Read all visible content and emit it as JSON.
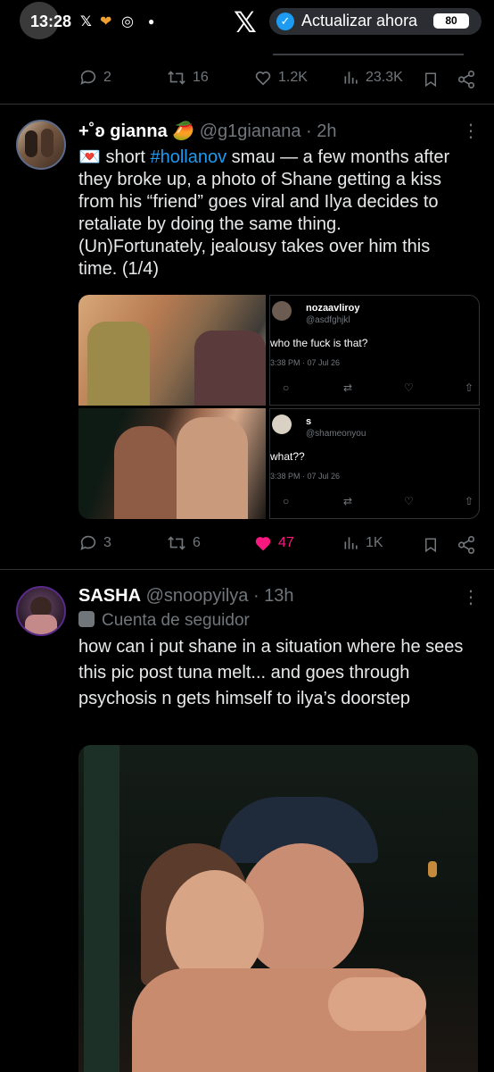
{
  "status_bar": {
    "time": "13:28",
    "app_icons": [
      "x-icon",
      "heart-icon",
      "whatsapp-icon",
      "dot-icon"
    ],
    "update_text": "Actualizar ahora",
    "battery": "80"
  },
  "tweet1": {
    "replies": "2",
    "retweets": "16",
    "likes": "1.2K",
    "views": "23.3K"
  },
  "tweet2": {
    "name": "+˚ʚ gianna 🥭",
    "handle": "@g1gianana",
    "time": "2h",
    "text_emoji": "💌",
    "text_before": " short ",
    "hashtag": "#hollanov",
    "text_after": " smau — a few months after they broke up, a photo of Shane getting a kiss from his “friend” goes viral and Ilya decides to retaliate by doing the same thing. (Un)Fortunately, jealousy takes over him this time. (1/4)",
    "embedded": [
      {
        "user": "nozaavliroy",
        "handle": "@asdfghjkl",
        "text": "who the fuck is that?",
        "timestamp": "3:38 PM · 07 Jul 26"
      },
      {
        "user": "s",
        "handle": "@shameonyou",
        "text": "what??",
        "timestamp": "3:38 PM · 07 Jul 26"
      }
    ],
    "replies": "3",
    "retweets": "6",
    "likes": "47",
    "views": "1K"
  },
  "tweet3": {
    "name": "SASHA",
    "handle": "@snoopyilya",
    "time": "13h",
    "account_label": "Cuenta de seguidor",
    "text": "how can i put shane in a situation where he sees this pic post tuna melt... and goes through psychosis n gets himself to ilya’s doorstep"
  },
  "colors": {
    "background": "#000000",
    "accent": "#1d9bf0",
    "like_active": "#f91880",
    "muted": "#71767b"
  }
}
